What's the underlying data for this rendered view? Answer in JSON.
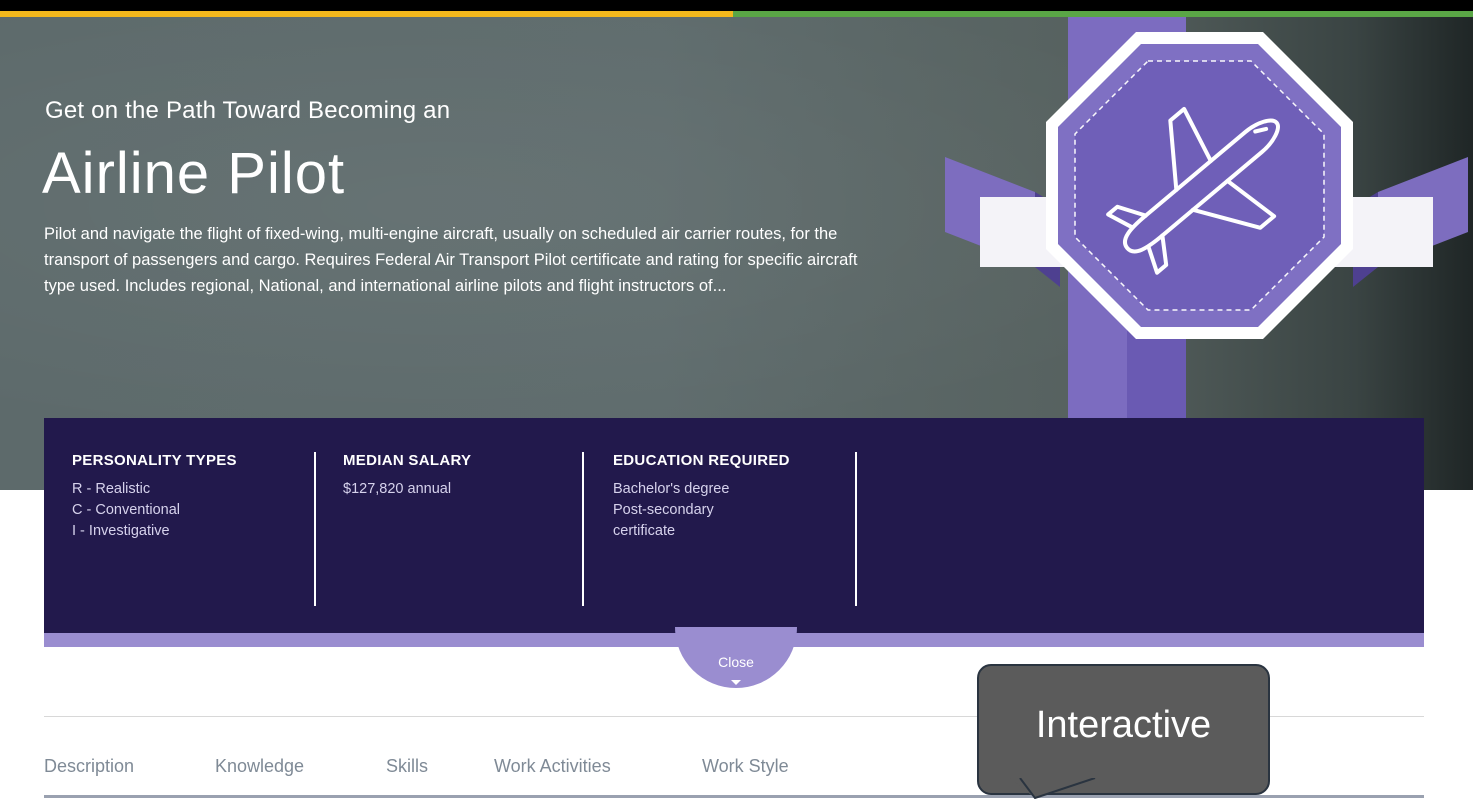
{
  "hero": {
    "subtitle": "Get on the Path Toward Becoming an",
    "title": "Airline Pilot",
    "description": "Pilot and navigate the flight of fixed-wing, multi-engine aircraft, usually on scheduled air carrier routes, for the transport of passengers and cargo. Requires Federal Air Transport Pilot certificate and rating for specific aircraft type used. Includes regional, National, and international airline pilots and flight instructors of...",
    "badge_icon": "airplane-icon"
  },
  "info": {
    "personality": {
      "heading": "PERSONALITY TYPES",
      "items": [
        "R - Realistic",
        "C - Conventional",
        "I - Investigative"
      ]
    },
    "salary": {
      "heading": "MEDIAN SALARY",
      "value": "$127,820 annual"
    },
    "education": {
      "heading": "EDUCATION REQUIRED",
      "items": [
        "Bachelor's degree",
        "Post-secondary",
        "certificate"
      ]
    }
  },
  "close_button": {
    "label": "Close"
  },
  "tabs": [
    "Description",
    "Knowledge",
    "Skills",
    "Work Activities",
    "Work Style"
  ],
  "callout": {
    "text": "Interactive"
  },
  "colors": {
    "accent_purple": "#7c6cc0",
    "navy": "#22194c",
    "gold": "#f3b81d",
    "green": "#5aa646"
  }
}
